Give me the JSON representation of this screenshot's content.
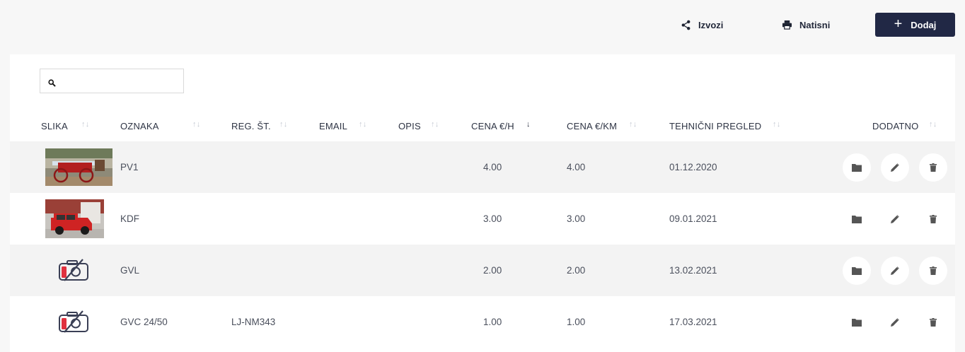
{
  "toolbar": {
    "export_label": "Izvozi",
    "print_label": "Natisni",
    "add_label": "Dodaj"
  },
  "search": {
    "value": "",
    "placeholder": ""
  },
  "table": {
    "columns": [
      {
        "key": "slika",
        "label": "SLIKA",
        "sort": "none"
      },
      {
        "key": "oznaka",
        "label": "OZNAKA",
        "sort": "none"
      },
      {
        "key": "reg",
        "label": "REG. ŠT.",
        "sort": "none"
      },
      {
        "key": "email",
        "label": "EMAIL",
        "sort": "none"
      },
      {
        "key": "opis",
        "label": "OPIS",
        "sort": "none"
      },
      {
        "key": "cena_h",
        "label": "CENA €/H",
        "sort": "descending"
      },
      {
        "key": "cena_km",
        "label": "CENA €/KM",
        "sort": "none"
      },
      {
        "key": "pregled",
        "label": "TEHNIČNI PREGLED",
        "sort": "none"
      },
      {
        "key": "dodatno",
        "label": "DODATNO",
        "sort": "none"
      }
    ],
    "rows": [
      {
        "image": "horse-drawn-fire-carriage-photo",
        "oznaka": "PV1",
        "reg": "",
        "email": "",
        "opis": "",
        "cena_h": "4.00",
        "cena_km": "4.00",
        "pregled": "01.12.2020"
      },
      {
        "image": "red-fire-jeep-photo",
        "oznaka": "KDF",
        "reg": "",
        "email": "",
        "opis": "",
        "cena_h": "3.00",
        "cena_km": "3.00",
        "pregled": "09.01.2021"
      },
      {
        "image": "no-photo-icon",
        "oznaka": "GVL",
        "reg": "",
        "email": "",
        "opis": "",
        "cena_h": "2.00",
        "cena_km": "2.00",
        "pregled": "13.02.2021"
      },
      {
        "image": "no-photo-icon",
        "oznaka": "GVC 24/50",
        "reg": "LJ-NM343",
        "email": "",
        "opis": "",
        "cena_h": "1.00",
        "cena_km": "1.00",
        "pregled": "17.03.2021"
      }
    ],
    "row_actions": [
      "folder-icon",
      "pencil-icon",
      "trash-icon"
    ]
  },
  "colors": {
    "primary": "#212845",
    "row_shade": "#f3f3f3",
    "page_bg": "#f7f7f7",
    "no_photo_red": "#e0313f"
  }
}
